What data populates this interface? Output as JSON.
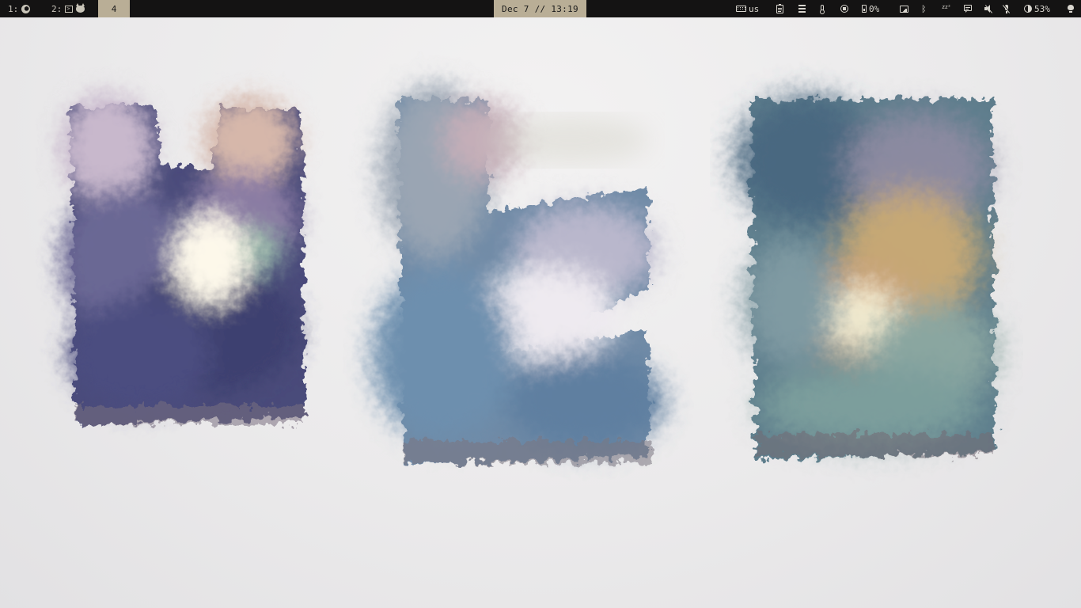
{
  "topbar": {
    "workspaces": [
      {
        "label": "1:",
        "app_icons": [
          "firefox-icon"
        ],
        "active": false
      },
      {
        "label": "2:",
        "app_icons": [
          "terminal-icon",
          "cat-icon"
        ],
        "active": false
      },
      {
        "label": "4",
        "app_icons": [],
        "active": true
      }
    ],
    "clock": "Dec 7 // 13:19",
    "tray": {
      "keyboard_layout": "us",
      "memory_usage": "0%",
      "brightness": "53%",
      "icons": [
        "keyboard-icon",
        "clipboard-icon",
        "storage-icon",
        "thermometer-icon",
        "cpu-icon",
        "memory-icon",
        "display-icon",
        "bluetooth-icon",
        "sleep-icon",
        "notifications-icon",
        "volume-muted-icon",
        "microphone-muted-icon",
        "brightness-icon",
        "lightbulb-icon"
      ]
    },
    "colors": {
      "bar_background": "#141313",
      "bar_foreground": "#d9d6cf",
      "accent": "#b9ae96"
    }
  },
  "wallpaper": {
    "background_color": "#ecebec",
    "panels": [
      {
        "name": "left-paint-panel",
        "palette": [
          "#3c3d6e",
          "#6f6b96",
          "#b8a9c4",
          "#d9b8ad",
          "#fbf6ea",
          "#8a7f9c"
        ]
      },
      {
        "name": "middle-paint-panel",
        "palette": [
          "#5c7f9e",
          "#8aa2b8",
          "#c7b8c6",
          "#f1eff2",
          "#b7b7c8",
          "#7c8ea6"
        ]
      },
      {
        "name": "right-paint-panel",
        "palette": [
          "#4d6e84",
          "#7f9aa0",
          "#c9a97c",
          "#f3ead0",
          "#8fb0a8",
          "#a98e9a"
        ]
      }
    ]
  }
}
